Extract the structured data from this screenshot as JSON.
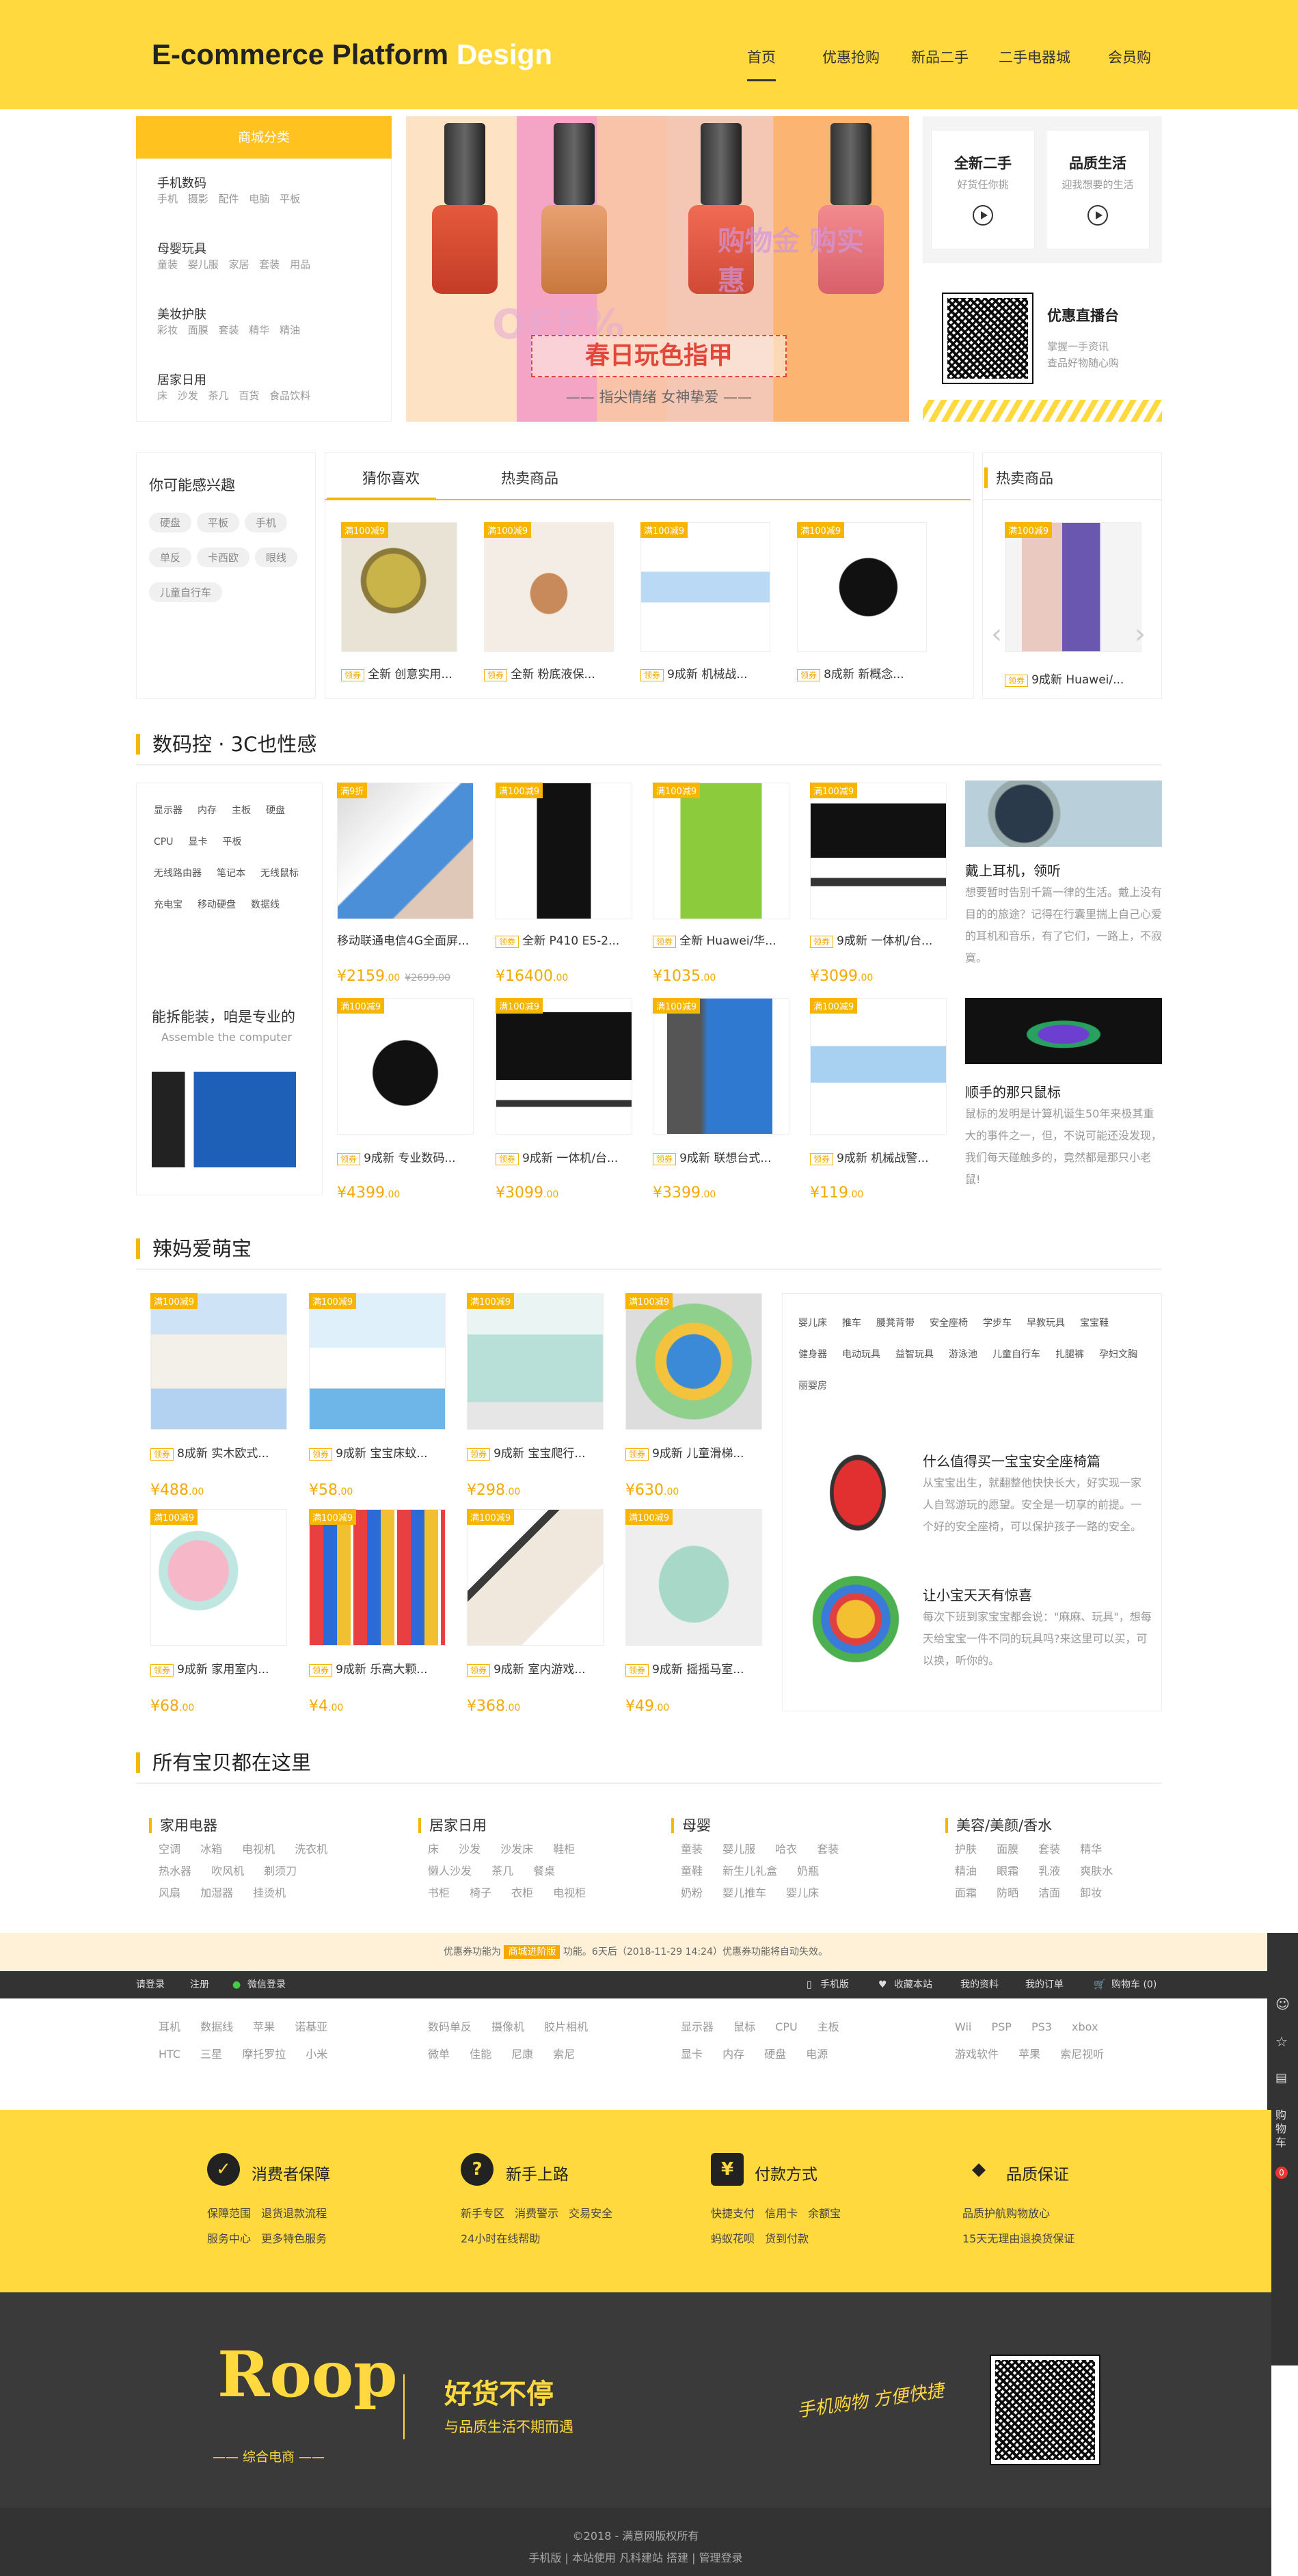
{
  "header": {
    "logo_main": "E-commerce Platform",
    "logo_accent": "Design",
    "nav": [
      "首页",
      "优惠抢购",
      "新品二手",
      "二手电器城",
      "会员购"
    ]
  },
  "category": {
    "title": "商城分类",
    "items": [
      {
        "name": "手机数码",
        "subs": "手机 摄影 配件 电脑 平板"
      },
      {
        "name": "母婴玩具",
        "subs": "童装 婴儿服 家居 套装 用品"
      },
      {
        "name": "美妆护肤",
        "subs": "彩妆 面膜 套装 精华 精油"
      },
      {
        "name": "居家日用",
        "subs": "床 沙发 茶几 百货 食品饮料"
      }
    ]
  },
  "banner": {
    "title": "春日玩色指甲",
    "subtitle": "—— 指尖情绪 女神挚爱 ——",
    "stamp": "购物金 购实惠",
    "off": "OFF%"
  },
  "promo": {
    "card1_title": "全新二手",
    "card1_sub": "好货任你挑",
    "card2_title": "品质生活",
    "card2_sub": "迎我想要的生活",
    "live_title": "优惠直播台",
    "live_line1": "掌握一手资讯",
    "live_line2": "查品好物随心购"
  },
  "interest": {
    "title": "你可能感兴趣",
    "tags": [
      "硬盘",
      "平板",
      "手机",
      "单反",
      "卡西欧",
      "眼线",
      "儿童自行车"
    ]
  },
  "guess": {
    "tabs": [
      "猜你喜欢",
      "热卖商品"
    ],
    "badge": "满100减9",
    "quan": "领券",
    "items": [
      "全新 创意实用...",
      "全新 粉底液保...",
      "9成新 机械战...",
      "8成新 新概念..."
    ],
    "hot_title": "热卖商品",
    "hot_item": "9成新 Huawei/..."
  },
  "digital": {
    "title": "数码控 · 3C也性感",
    "tags": [
      "显示器",
      "内存",
      "主板",
      "硬盘",
      "CPU",
      "显卡",
      "平板",
      "无线路由器",
      "笔记本",
      "无线鼠标",
      "充电宝",
      "移动硬盘",
      "数据线"
    ],
    "promo_title": "能拆能装，咱是专业的",
    "promo_sub": "Assemble the computer",
    "first_badge": "满9折",
    "products": [
      {
        "name": "移动联通电信4G全面屏...",
        "price": "2159",
        "dec": ".00",
        "old": "¥2699.00"
      },
      {
        "name": "全新 P410 E5-2...",
        "price": "16400",
        "dec": ".00",
        "old": ""
      },
      {
        "name": "全新 Huawei/华...",
        "price": "1035",
        "dec": ".00",
        "old": ""
      },
      {
        "name": "9成新 一体机/台...",
        "price": "3099",
        "dec": ".00",
        "old": ""
      },
      {
        "name": "9成新 专业数码...",
        "price": "4399",
        "dec": ".00",
        "old": ""
      },
      {
        "name": "9成新 一体机/台...",
        "price": "3099",
        "dec": ".00",
        "old": ""
      },
      {
        "name": "9成新 联想台式...",
        "price": "3399",
        "dec": ".00",
        "old": ""
      },
      {
        "name": "9成新 机械战警...",
        "price": "119",
        "dec": ".00",
        "old": ""
      }
    ],
    "art1_title": "戴上耳机，领听",
    "art1_text": "想要暂时告别千篇一律的生活。戴上没有目的的旅途？记得在行囊里揣上自己心爱的耳机和音乐，有了它们，一路上，不寂寞。",
    "art2_title": "顺手的那只鼠标",
    "art2_text": "鼠标的发明是计算机诞生50年来极其重大的事件之一，但，不说可能还没发现，我们每天碰触多的，竟然都是那只小老鼠!"
  },
  "baby": {
    "title": "辣妈爱萌宝",
    "products": [
      {
        "name": "8成新 实木欧式...",
        "price": "488",
        "dec": ".00"
      },
      {
        "name": "9成新 宝宝床蚊...",
        "price": "58",
        "dec": ".00"
      },
      {
        "name": "9成新 宝宝爬行...",
        "price": "298",
        "dec": ".00"
      },
      {
        "name": "9成新 儿童滑梯...",
        "price": "630",
        "dec": ".00"
      },
      {
        "name": "9成新 家用室内...",
        "price": "68",
        "dec": ".00"
      },
      {
        "name": "9成新 乐高大颗...",
        "price": "4",
        "dec": ".00"
      },
      {
        "name": "9成新 室内游戏...",
        "price": "368",
        "dec": ".00"
      },
      {
        "name": "9成新 摇摇马室...",
        "price": "49",
        "dec": ".00"
      }
    ],
    "tags": [
      "婴儿床",
      "推车",
      "腰凳背带",
      "安全座椅",
      "学步车",
      "早教玩具",
      "宝宝鞋",
      "健身器",
      "电动玩具",
      "益智玩具",
      "游泳池",
      "儿童自行车",
      "扎腿裤",
      "孕妇文胸",
      "丽婴房"
    ],
    "art1_title": "什么值得买一宝宝安全座椅篇",
    "art1_text": "从宝宝出生，就翻整他快快长大，好实现一家人自驾游玩的愿望。安全是一切享的前提。一个好的安全座椅，可以保护孩子一路的安全。",
    "art2_title": "让小宝天天有惊喜",
    "art2_text": "每次下班到家宝宝都会说：\"麻麻、玩具\"，想每天给宝宝一件不同的玩具吗?来这里可以买，可以换，听你的。"
  },
  "allgoods": {
    "title": "所有宝贝都在这里",
    "cols": [
      {
        "head": "家用电器",
        "r1": "空调 冰箱 电视机 洗衣机",
        "r2": "热水器 吹风机 剃须刀",
        "r3": "风扇 加湿器 挂烫机",
        "r4": "耳机 数据线 苹果 诺基亚",
        "r5": "HTC 三星 摩托罗拉 小米"
      },
      {
        "head": "居家日用",
        "r1": "床 沙发 沙发床 鞋柜",
        "r2": "懒人沙发 茶几 餐桌",
        "r3": "书柜 椅子 衣柜 电视柜",
        "r4": "数码单反 摄像机 胶片相机",
        "r5": "微单 佳能 尼康 索尼"
      },
      {
        "head": "母婴",
        "r1": "童装 婴儿服 哈衣 套装",
        "r2": "童鞋 新生儿礼盒 奶瓶",
        "r3": "奶粉 婴儿推车 婴儿床",
        "r4": "显示器 鼠标 CPU 主板",
        "r5": "显卡 内存 硬盘 电源"
      },
      {
        "head": "美容/美颜/香水",
        "r1": "护肤 面膜 套装 精华",
        "r2": "精油 眼霜 乳液 爽肤水",
        "r3": "面霜 防晒 洁面 卸妆",
        "r4": "Wii PSP PS3 xbox",
        "r5": "游戏软件 苹果 索尼视听"
      }
    ]
  },
  "notice": {
    "pre": "优惠券功能为",
    "tag": "商城进阶版",
    "post": "功能。6天后（2018-11-29 14:24）优惠券功能将自动失效。"
  },
  "topbar": {
    "login": "请登录",
    "register": "注册",
    "wechat": "微信登录",
    "mobile": "手机版",
    "fav": "收藏本站",
    "profile": "我的资料",
    "orders": "我的订单",
    "cart": "购物车 (0)"
  },
  "rside": {
    "cart": "购物车",
    "count": "0"
  },
  "service": [
    {
      "title": "消费者保障",
      "l1": "保障范围 退货退款流程",
      "l2": "服务中心 更多特色服务"
    },
    {
      "title": "新手上路",
      "l1": "新手专区 消费警示 交易安全",
      "l2": "24小时在线帮助"
    },
    {
      "title": "付款方式",
      "l1": "快捷支付 信用卡 余额宝",
      "l2": "蚂蚁花呗 货到付款"
    },
    {
      "title": "品质保证",
      "l1": "品质护航购物放心",
      "l2": "15天无理由退换货保证"
    }
  ],
  "footer": {
    "logo": "Roop",
    "logo_sub": "综合电商",
    "slogan": "好货不停",
    "slogan_sub": "与品质生活不期而遇",
    "script": "手机购物 方便快捷"
  },
  "copyright": {
    "line1": "©2018 - 满意网版权所有",
    "line2": "手机版 | 本站使用 凡科建站 搭建 | 管理登录"
  }
}
